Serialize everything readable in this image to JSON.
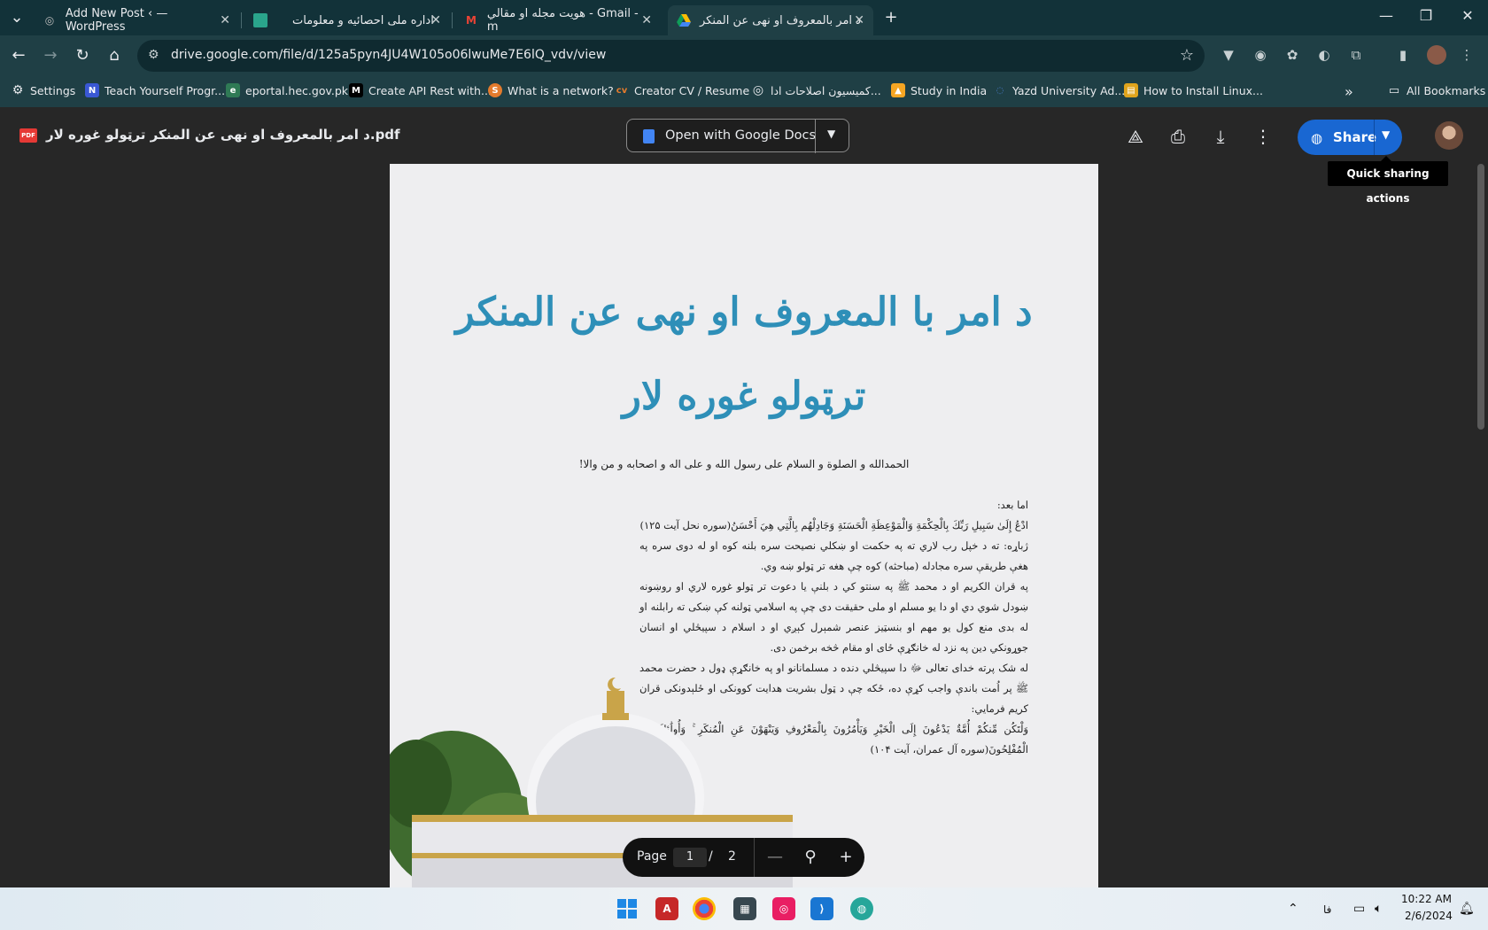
{
  "tabs": [
    {
      "label": "Add New Post ‹ — WordPress"
    },
    {
      "label": "اداره ملی احصائیه و معلومات"
    },
    {
      "label": "هويت مجله او مقالي - Gmail - m"
    },
    {
      "label": "د امر بالمعروف او نهی عن المنکر"
    }
  ],
  "address": {
    "url": "drive.google.com/file/d/125a5pyn4JU4W105o06lwuMe7E6lQ_vdv/view"
  },
  "bookmarks": [
    {
      "label": "Settings"
    },
    {
      "label": "Teach Yourself Progr..."
    },
    {
      "label": "eportal.hec.gov.pk"
    },
    {
      "label": "Create API Rest with..."
    },
    {
      "label": "What is a network?"
    },
    {
      "label": "Creator CV / Resume"
    },
    {
      "label": "کمیسیون اصلاحات ادا..."
    },
    {
      "label": "Study in India"
    },
    {
      "label": "Yazd University Ad..."
    },
    {
      "label": "How to Install Linux..."
    }
  ],
  "all_bookmarks": "All Bookmarks",
  "viewer": {
    "file_name": "د امر بالمعروف او نهی عن المنکر ترټولو غوره لار.pdf",
    "pdf_badge": "PDF",
    "open_with": "Open with Google Docs",
    "share": "Share",
    "tooltip": "Quick sharing actions"
  },
  "document": {
    "title_line1": "د امر با المعروف او نهی عن المنکر",
    "title_line2": "ترټولو غوره لار",
    "intro": "الحمدالله و الصلوة و السلام علی رسول الله و علی اله و اصحابه و من والا!",
    "paragraphs": [
      "اما بعد:",
      "ادْعُ إِلَىٰ سَبِيلِ رَبِّكَ بِالْحِكْمَةِ وَالْمَوْعِظَةِ الْحَسَنَةِ وَجَادِلْهُم بِالَّتِي هِيَ أَحْسَنُ(سوره نحل آیت ۱۲۵)",
      "ژباړه: ته د خپل رب لاري ته په حکمت او ښکلي نصیحت سره بلنه کوه او له دوی سره په هغې طریقې سره مجادله (مباحثه) کوه چې هغه تر ټولو ښه وي.",
      "په قران الکریم او د محمد ﷺ په سنتو کي د بلنې یا دعوت تر ټولو غوره لاري او روښونه ښودل شوي دي او دا یو مسلم او ملی حقیقت دی چې په اسلامي ټولنه کې ښکی ته رابلنه او له بدی منع کول یو مهم او بنسټیز عنصر شمېرل کېږي او د اسلام د سپیڅلي او انسان جوړونکي دین په نزد له خانګړې ځای او مقام څخه برخمن دی.",
      "له شک پرته خدای تعالی ﷻ دا سپیڅلي دنده د مسلمانانو او په خانګړې ډول د حضرت محمد ﷺ پر اُمت باندې واجب کړې ده، ځکه چې د ټول بشریت هدایت کوونکی او ځلېدونکی قران کریم فرمایي:",
      "وَلْتَكُن مِّنكُمْ أُمَّةٌ يَدْعُونَ إِلَى الْخَيْرِ وَيَأْمُرُونَ بِالْمَعْرُوفِ وَيَنْهَوْنَ عَنِ الْمُنكَرِ ۚ وَأُولَٰئِكَ هُمُ الْمُفْلِحُونَ(سوره آل عمران، آیت ۱۰۴)"
    ]
  },
  "pager": {
    "label": "Page",
    "current": "1",
    "separator": "/",
    "total": "2"
  },
  "taskbar": {
    "lang": "فا",
    "time": "10:22 AM",
    "date": "2/6/2024"
  },
  "colors": {
    "title_blue": "#2e8fb8",
    "share_blue": "#1967d2",
    "chrome_bg": "#1f3f45"
  }
}
